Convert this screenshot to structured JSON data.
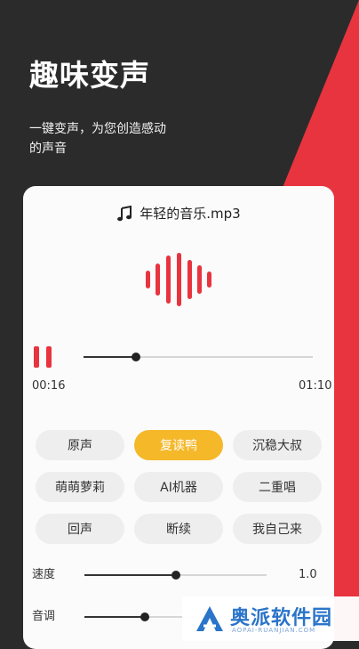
{
  "headline": "趣味变声",
  "subtitle": "一键变声，为您创造感动的声音",
  "player": {
    "file_name": "年轻的音乐.mp3",
    "current_time": "00:16",
    "total_time": "01:10",
    "progress": 0.23,
    "colors": {
      "accent": "#e8343f",
      "active_effect": "#f5b829"
    }
  },
  "effects": [
    "原声",
    "复读鸭",
    "沉稳大叔",
    "萌萌萝莉",
    "AI机器",
    "二重唱",
    "回声",
    "断续",
    "我自己来"
  ],
  "active_effect": "复读鸭",
  "speed": {
    "label": "速度",
    "value": "1.0",
    "position": 0.5
  },
  "pitch": {
    "label": "音调",
    "position": 0.33
  },
  "watermark": {
    "text": "奥派软件园",
    "sub": "AOPAI-RUANJIAN.COM"
  }
}
